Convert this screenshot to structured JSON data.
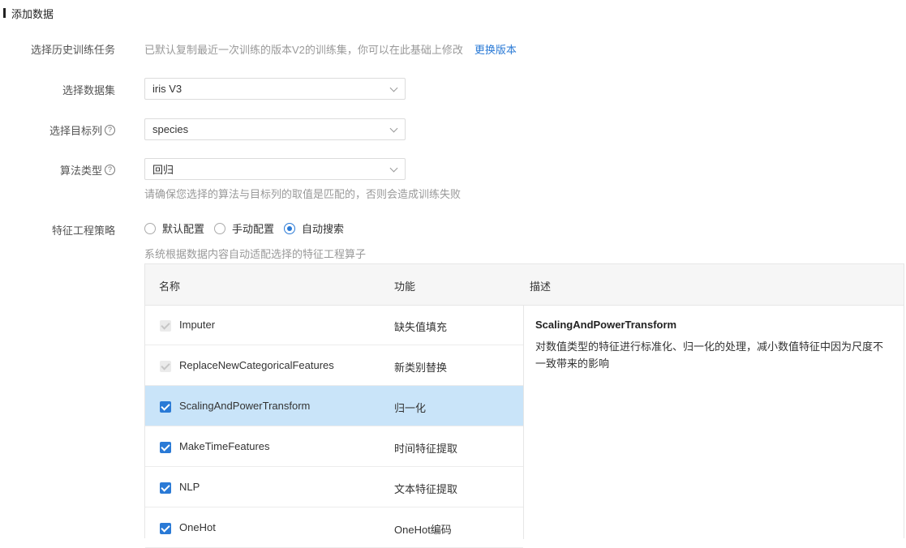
{
  "section": {
    "title": "添加数据"
  },
  "history": {
    "label": "选择历史训练任务",
    "hint": "已默认复制最近一次训练的版本V2的训练集，你可以在此基础上修改",
    "link": "更换版本"
  },
  "dataset": {
    "label": "选择数据集",
    "value": "iris V3"
  },
  "target": {
    "label": "选择目标列",
    "help": "?",
    "value": "species"
  },
  "algorithm": {
    "label": "算法类型",
    "help": "?",
    "value": "回归",
    "hint": "请确保您选择的算法与目标列的取值是匹配的，否则会造成训练失败"
  },
  "feature": {
    "label": "特征工程策略",
    "options": [
      "默认配置",
      "手动配置",
      "自动搜索"
    ],
    "selected": "自动搜索",
    "hint": "系统根据数据内容自动适配选择的特征工程算子"
  },
  "table": {
    "headers": {
      "name": "名称",
      "func": "功能",
      "desc": "描述"
    },
    "rows": [
      {
        "name": "Imputer",
        "func": "缺失值填充",
        "checked": true,
        "disabled": true
      },
      {
        "name": "ReplaceNewCategoricalFeatures",
        "func": "新类别替换",
        "checked": true,
        "disabled": true
      },
      {
        "name": "ScalingAndPowerTransform",
        "func": "归一化",
        "checked": true,
        "disabled": false,
        "selected": true
      },
      {
        "name": "MakeTimeFeatures",
        "func": "时间特征提取",
        "checked": true,
        "disabled": false
      },
      {
        "name": "NLP",
        "func": "文本特征提取",
        "checked": true,
        "disabled": false
      },
      {
        "name": "OneHot",
        "func": "OneHot编码",
        "checked": true,
        "disabled": false
      }
    ],
    "detail": {
      "title": "ScalingAndPowerTransform",
      "text": "对数值类型的特征进行标准化、归一化的处理，减小数值特征中因为尺度不一致带来的影响"
    }
  },
  "colors": {
    "accent": "#2a7ad6",
    "selected_row": "#c9e4f9"
  }
}
